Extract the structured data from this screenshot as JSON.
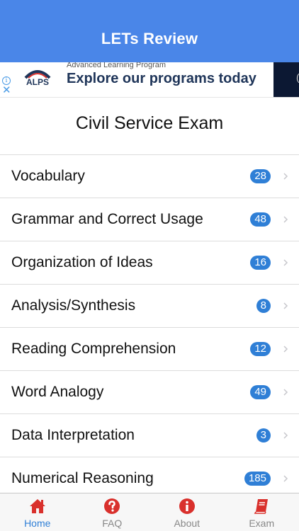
{
  "app": {
    "title": "LETs Review"
  },
  "ad": {
    "subtitle": "Advanced Learning Program",
    "headline": "Explore our programs today",
    "logo_text": "ALPS",
    "info_icon": "info-icon",
    "close_icon": "close-icon"
  },
  "page": {
    "title": "Civil Service Exam"
  },
  "categories": [
    {
      "label": "Vocabulary",
      "count": "28"
    },
    {
      "label": "Grammar and Correct Usage",
      "count": "48"
    },
    {
      "label": "Organization of Ideas",
      "count": "16"
    },
    {
      "label": "Analysis/Synthesis",
      "count": "8"
    },
    {
      "label": "Reading Comprehension",
      "count": "12"
    },
    {
      "label": "Word Analogy",
      "count": "49"
    },
    {
      "label": "Data Interpretation",
      "count": "3"
    },
    {
      "label": "Numerical Reasoning",
      "count": "185"
    }
  ],
  "tabs": [
    {
      "label": "Home",
      "icon": "home-icon",
      "active": true
    },
    {
      "label": "FAQ",
      "icon": "question-icon",
      "active": false
    },
    {
      "label": "About",
      "icon": "info-icon",
      "active": false
    },
    {
      "label": "Exam",
      "icon": "book-icon",
      "active": false
    }
  ],
  "colors": {
    "navbar": "#4a86e8",
    "badge": "#2f7fd6",
    "tab_icon": "#d9302c",
    "tab_active": "#2f7fd6"
  }
}
